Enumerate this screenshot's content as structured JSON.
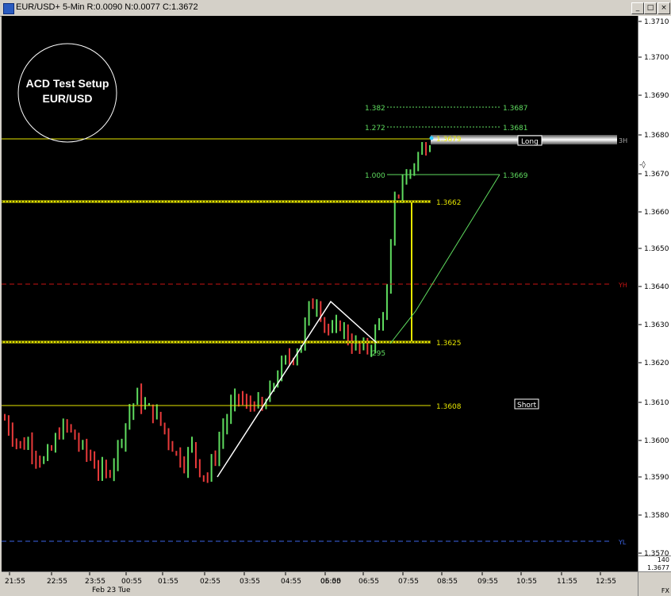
{
  "window": {
    "title": "EUR/USD+ 5-Min R:0.0090 N:0.0077 C:1.3672",
    "minimize_glyph": "_",
    "maximize_glyph": "□",
    "close_glyph": "×"
  },
  "overlay": {
    "line1": "ACD Test Setup",
    "line2": "EUR/USD"
  },
  "price_axis": {
    "ticks": [
      "1.3710",
      "1.3700",
      "1.3690",
      "1.3680",
      "1.3670",
      "1.3660",
      "1.3650",
      "1.3640",
      "1.3630",
      "1.3620",
      "1.3610",
      "1.3600",
      "1.3590",
      "1.3580",
      "1.3570"
    ],
    "volume": "140",
    "last_price": "1.3677",
    "corner_label": "FX"
  },
  "time_axis": {
    "ticks": [
      "21:55",
      "22:55",
      "23:55",
      "00:55",
      "01:55",
      "02:55",
      "03:55",
      "04:55",
      "05:55",
      "06:00",
      "06:55",
      "07:55",
      "08:55",
      "09:55",
      "10:55",
      "11:55",
      "12:55"
    ],
    "date_label": "Feb 23 Tue"
  },
  "levels": {
    "l1679": "1.3679",
    "l1662": "1.3662",
    "l1625": "1.3625",
    "l1608": "1.3608",
    "yh": "YH",
    "yl": "YL",
    "three_h": "3H",
    "long": "Long",
    "short": "Short"
  },
  "fib": {
    "r1382": "1.382",
    "p1382": "1.3687",
    "r1272": "1.272",
    "p1272": "1.3681",
    "r1000": "1.000",
    "p1000": "1.3669",
    "r295": ".295"
  },
  "colors": {
    "up_bar": "#5fdc5f",
    "down_bar": "#e83a3a",
    "level_line": "#e6e600",
    "fib_line": "#5fdc5f",
    "yh_line": "#c81414",
    "yl_line": "#3c64e6",
    "wedge": "#ffffff"
  },
  "chart_data": {
    "type": "ohlc",
    "symbol": "EUR/USD",
    "interval": "5-Min",
    "ylim": [
      1.3568,
      1.3713
    ],
    "horizontal_levels": [
      1.3679,
      1.3662,
      1.3625,
      1.3608,
      1.364,
      1.3573
    ],
    "fib_levels": [
      {
        "ratio": "1.382",
        "price": 1.3687
      },
      {
        "ratio": "1.272",
        "price": 1.3681
      },
      {
        "ratio": "1.000",
        "price": 1.3669
      },
      {
        "ratio": ".295",
        "price": 1.3622
      }
    ],
    "bars_close_path": [
      1.3605,
      1.3601,
      1.3598,
      1.3599,
      1.3596,
      1.3594,
      1.3597,
      1.3602,
      1.3603,
      1.36,
      1.3597,
      1.3595,
      1.3592,
      1.359,
      1.3595,
      1.3601,
      1.3607,
      1.3611,
      1.3608,
      1.3607,
      1.3604,
      1.36,
      1.3596,
      1.3594,
      1.3598,
      1.3592,
      1.359,
      1.3596,
      1.3603,
      1.3608,
      1.3611,
      1.3608,
      1.361,
      1.3607,
      1.3612,
      1.3617,
      1.362,
      1.3622,
      1.3625,
      1.3634,
      1.3636,
      1.363,
      1.3627,
      1.363,
      1.3626,
      1.3624,
      1.3623,
      1.3625,
      1.363,
      1.3637,
      1.3662,
      1.3667,
      1.367,
      1.3674,
      1.3677
    ]
  }
}
